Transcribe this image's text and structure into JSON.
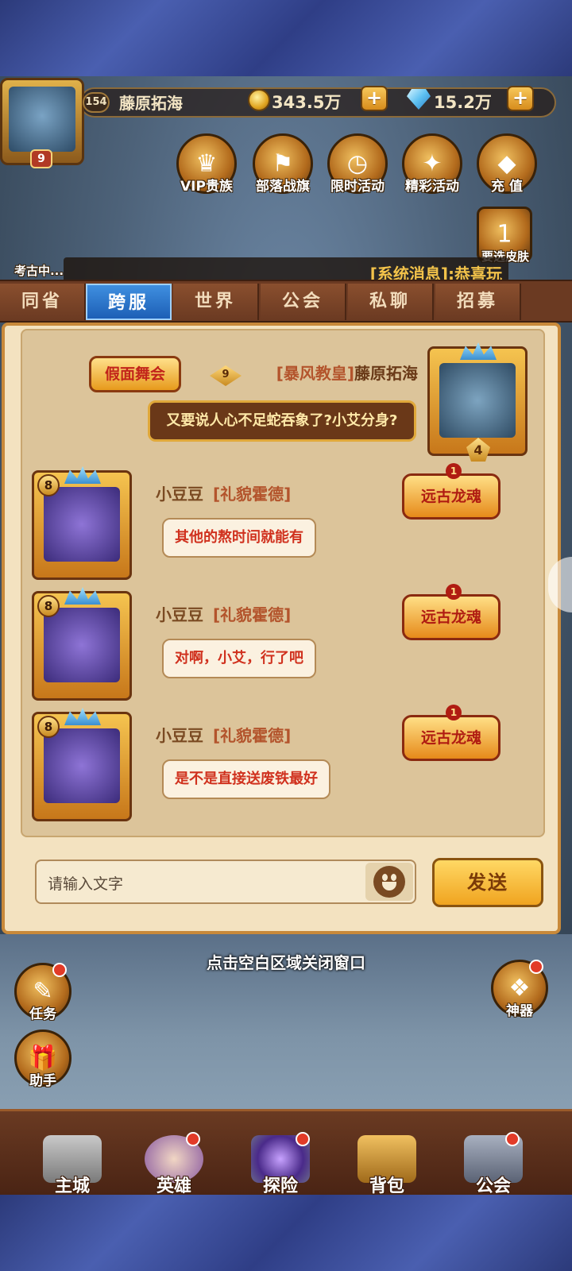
{
  "player": {
    "level": "154",
    "name": "藤原拓海",
    "avatar_level": "9",
    "gold": "343.5万",
    "gems": "15.2万"
  },
  "hud_buttons": [
    {
      "label": "VIP贵族",
      "icon": "crown-icon"
    },
    {
      "label": "部落战旗",
      "icon": "war-banner-icon"
    },
    {
      "label": "限时活动",
      "icon": "clock-icon"
    },
    {
      "label": "精彩活动",
      "icon": "scroll-icon"
    },
    {
      "label": "充 值",
      "icon": "gem-icon"
    }
  ],
  "side_labels": {
    "archaeology": "考古中...",
    "skin": "要选皮肤",
    "skin_count": "1"
  },
  "system_message": "[系统消息]:恭喜玩",
  "tabs": [
    "同省",
    "跨服",
    "世界",
    "公会",
    "私聊",
    "招募"
  ],
  "active_tab": "跨服",
  "self_message": {
    "badge": "假面舞会",
    "level": "9",
    "guild": "[暴风教皇]",
    "name": "藤原拓海",
    "text": "又要说人心不足蛇吞象了?小艾分身?",
    "portrait_level": "4"
  },
  "messages": [
    {
      "level": "8",
      "name": "小豆豆",
      "guild": "[礼貌霍德]",
      "text": "其他的熬时间就能有",
      "badge": "远古龙魂",
      "badge_num": "1"
    },
    {
      "level": "8",
      "name": "小豆豆",
      "guild": "[礼貌霍德]",
      "text": "对啊，小艾，行了吧",
      "badge": "远古龙魂",
      "badge_num": "1"
    },
    {
      "level": "8",
      "name": "小豆豆",
      "guild": "[礼貌霍德]",
      "text": "是不是直接送废铁最好",
      "badge": "远古龙魂",
      "badge_num": "1"
    }
  ],
  "input": {
    "placeholder": "请输入文字"
  },
  "send_label": "发送",
  "close_hint": "点击空白区域关闭窗口",
  "side_buttons": [
    {
      "label": "任务",
      "icon": "quest-icon"
    },
    {
      "label": "助手",
      "icon": "gift-icon"
    },
    {
      "label": "神器",
      "icon": "artifact-icon"
    }
  ],
  "bottom_nav": [
    {
      "label": "主城",
      "icon": "castle-icon"
    },
    {
      "label": "英雄",
      "icon": "hero-icon"
    },
    {
      "label": "探险",
      "icon": "portal-icon"
    },
    {
      "label": "背包",
      "icon": "backpack-icon"
    },
    {
      "label": "公会",
      "icon": "guild-tower-icon"
    }
  ]
}
